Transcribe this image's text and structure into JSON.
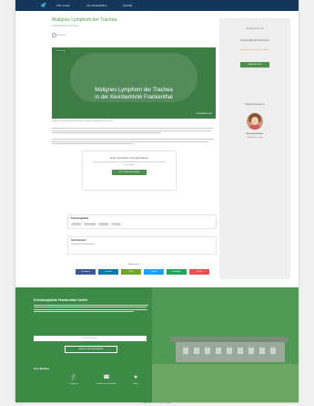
{
  "nav": {
    "items": [
      "Fürs Leben",
      "Für Arbeitsplätze",
      "Kontakt"
    ]
  },
  "article": {
    "title": "Malignes Lymphom der Trachea",
    "subtitle": "Krankheitsbild und Therapie",
    "meta": "Lesezeit",
    "hero_badge": "Fachbeitrag",
    "hero_line1": "Malignes Lymphom der Trachea",
    "hero_line2": "in der Kleinberklinik Frankenthal",
    "hero_brand": "KLEINBERKLINIK",
    "caption": "Quelle: Kleinbergklinik Frankenthal · Malignes Lymphom der Trachea"
  },
  "consent": {
    "title": "Jetzt anmelden und weiterlesen",
    "text": "Registrieren Sie sich kostenlos, um den vollständigen Beitrag zu lesen und weitere Inhalte freizuschalten.",
    "button": "JETZT REGISTRIEREN"
  },
  "keywords": {
    "title": "Themengebiete",
    "tags": [
      "Onkologie",
      "Pneumologie",
      "Radiologie",
      "Chirurgie"
    ]
  },
  "authors": {
    "title": "Autor/Autorin",
    "text": "Kleinbergklinik Frankenthal"
  },
  "share": {
    "heading": "Artikel teilen",
    "buttons": [
      {
        "label": "Facebook",
        "color": "#3b5998"
      },
      {
        "label": "LinkedIn",
        "color": "#0e76a8"
      },
      {
        "label": "XING",
        "color": "#6ea62e"
      },
      {
        "label": "Twitter",
        "color": "#1da1f2"
      },
      {
        "label": "WhatsApp",
        "color": "#25a35a"
      },
      {
        "label": "E-Mail",
        "color": "#e0564e"
      }
    ]
  },
  "sidebar": {
    "heading1": "Veröffentlicht von",
    "heading2": "Kleinbergklinik Frankenthal",
    "note": "Angebot und Service für die Region",
    "button": "NEWSLETTER",
    "contact_title": "Ansprechpartner:in",
    "contact_name": "Natascha Schaller",
    "contact_role": "Öffentlichkeitsarbeit"
  },
  "footer": {
    "title": "Kleinbergklinik Frankenthal GmbH",
    "input_placeholder": "Mail hier eintragen",
    "button": "NEWSLETTER ABONNIEREN",
    "subtitle": "Top 3 Bereiche",
    "icons": [
      {
        "glyph": "🍴",
        "label": "Verpflegung"
      },
      {
        "glyph": "☎",
        "label": "Kontakt und Unterstützung"
      },
      {
        "glyph": "♥",
        "label": "Pflege"
      }
    ],
    "bottom": "Impressum · Datenschutz · Kontakt"
  },
  "colors": {
    "accent": "#4e8f4e",
    "nav": "#13365a"
  }
}
